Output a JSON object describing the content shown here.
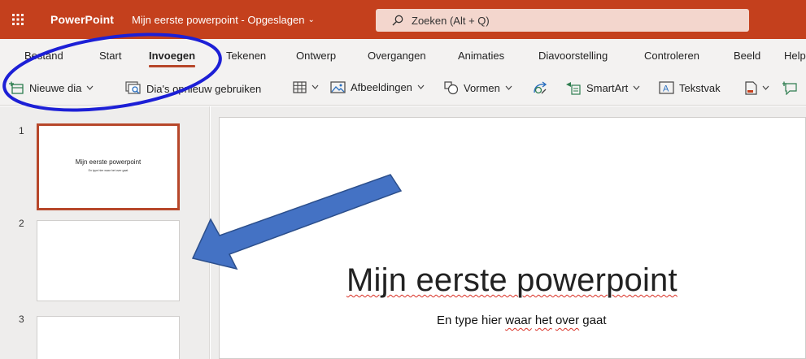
{
  "titlebar": {
    "app_launcher_icon": "waffle-grid-icon",
    "app_name": "PowerPoint",
    "document_title": "Mijn eerste powerpoint - Opgeslagen",
    "document_title_chevron": "⌄",
    "brand_color": "#c4401d"
  },
  "search": {
    "icon": "search-icon",
    "placeholder": "Zoeken (Alt + Q)"
  },
  "ribbon": {
    "tabs": [
      "Bestand",
      "Start",
      "Invoegen",
      "Tekenen",
      "Ontwerp",
      "Overgangen",
      "Animaties",
      "Diavoorstelling",
      "Controleren",
      "Beeld",
      "Help"
    ],
    "active_tab": "Invoegen"
  },
  "toolbar": {
    "new_slide": "Nieuwe dia",
    "reuse_slides": "Dia's opnieuw gebruiken",
    "images": "Afbeeldingen",
    "shapes": "Vormen",
    "smartart": "SmartArt",
    "textbox": "Tekstvak"
  },
  "slides_pane": {
    "slides": [
      {
        "number": "1",
        "title": "Mijn eerste powerpoint",
        "subtitle": "En type hier waar het over gaat",
        "selected": true
      },
      {
        "number": "2",
        "title": "",
        "subtitle": "",
        "selected": false
      },
      {
        "number": "3",
        "title": "",
        "subtitle": "",
        "selected": false
      }
    ]
  },
  "current_slide": {
    "title": "Mijn eerste powerpoint",
    "subtitle_parts": [
      "En type hier ",
      "waar",
      " ",
      "het",
      " ",
      "over",
      " ",
      "gaat"
    ]
  },
  "annotations": {
    "highlight_ellipse_color": "#1c1fd6",
    "arrow_color": "#4472c4"
  }
}
